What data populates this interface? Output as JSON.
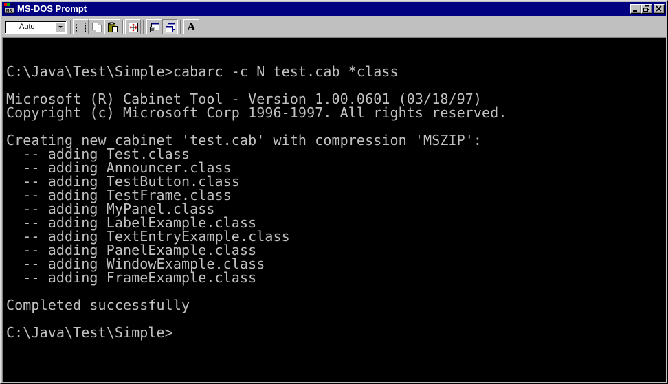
{
  "window": {
    "title": "MS-DOS Prompt",
    "controls": {
      "minimize": "_",
      "maximize": "▫",
      "close": "×"
    }
  },
  "toolbar": {
    "font_size_value": "Auto",
    "tools": [
      {
        "name": "mark-tool-button",
        "icon": "marquee-icon"
      },
      {
        "name": "copy-tool-button",
        "icon": "copy-icon"
      },
      {
        "name": "paste-tool-button",
        "icon": "paste-icon"
      },
      {
        "name": "fullscreen-tool-button",
        "icon": "fullscreen-icon"
      },
      {
        "name": "properties-tool-button",
        "icon": "properties-icon"
      },
      {
        "name": "background-tool-button",
        "icon": "background-icon"
      },
      {
        "name": "font-tool-button",
        "icon": "font-icon"
      }
    ],
    "font_button_label": "A"
  },
  "console": {
    "text_color": "#c0c0c0",
    "background_color": "#000000",
    "lines": [
      "",
      "C:\\Java\\Test\\Simple>cabarc -c N test.cab *class",
      "",
      "Microsoft (R) Cabinet Tool - Version 1.00.0601 (03/18/97)",
      "Copyright (c) Microsoft Corp 1996-1997. All rights reserved.",
      "",
      "Creating new cabinet 'test.cab' with compression 'MSZIP':",
      "  -- adding Test.class",
      "  -- adding Announcer.class",
      "  -- adding TestButton.class",
      "  -- adding TestFrame.class",
      "  -- adding MyPanel.class",
      "  -- adding LabelExample.class",
      "  -- adding TextEntryExample.class",
      "  -- adding PanelExample.class",
      "  -- adding WindowExample.class",
      "  -- adding FrameExample.class",
      "",
      "Completed successfully",
      "",
      "C:\\Java\\Test\\Simple>"
    ]
  }
}
